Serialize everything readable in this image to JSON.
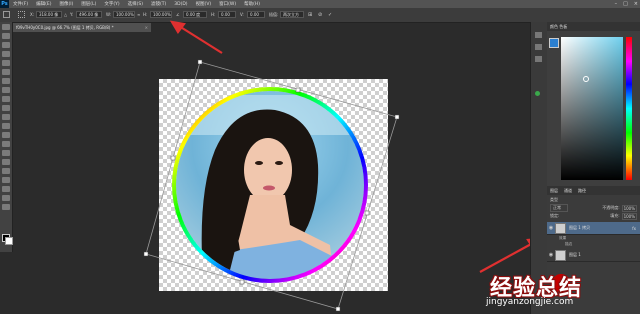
{
  "app": {
    "logo": "Ps",
    "menus": [
      "文件(F)",
      "编辑(E)",
      "图像(I)",
      "图层(L)",
      "文字(Y)",
      "选择(S)",
      "滤镜(T)",
      "3D(D)",
      "视图(V)",
      "窗口(W)",
      "帮助(H)"
    ]
  },
  "options_bar": {
    "x_value": "318.00 像",
    "y_value": "496.00 像",
    "w_value": "100.00%",
    "h_value": "100.00%",
    "angle_value": "0.00 度",
    "h_skew": "0.00",
    "v_skew": "0.00",
    "interpolation": "两次立方",
    "cancel_icon": "cancel-icon",
    "commit_icon": "checkmark-icon"
  },
  "document": {
    "tab_title": "f09vTH0y0C0.jpg @ 66.7% (图层 1 拷贝, RGB/8) *",
    "close_glyph": "×"
  },
  "panels": {
    "color_tabs": "颜色  色板",
    "layers_tabs": [
      "图层",
      "通道",
      "路径"
    ],
    "kind_label": "类型",
    "blend_mode": "正常",
    "opacity_label": "不透明度:",
    "opacity_value": "100%",
    "lock_label": "锁定:",
    "fill_label": "填充:",
    "fill_value": "100%",
    "layers": [
      {
        "name": "图层 1 拷贝",
        "effects": [
          "效果",
          "描边"
        ]
      },
      {
        "name": "图层 1"
      }
    ]
  },
  "watermark": {
    "text": "经验总结",
    "url": "jingyanzongjie.com"
  },
  "colors": {
    "ring_gradient": [
      "#ff0000",
      "#ffff00",
      "#00ff00",
      "#00ffff",
      "#0000ff",
      "#ff00ff",
      "#ff0000"
    ],
    "arrow": "#e03030"
  }
}
